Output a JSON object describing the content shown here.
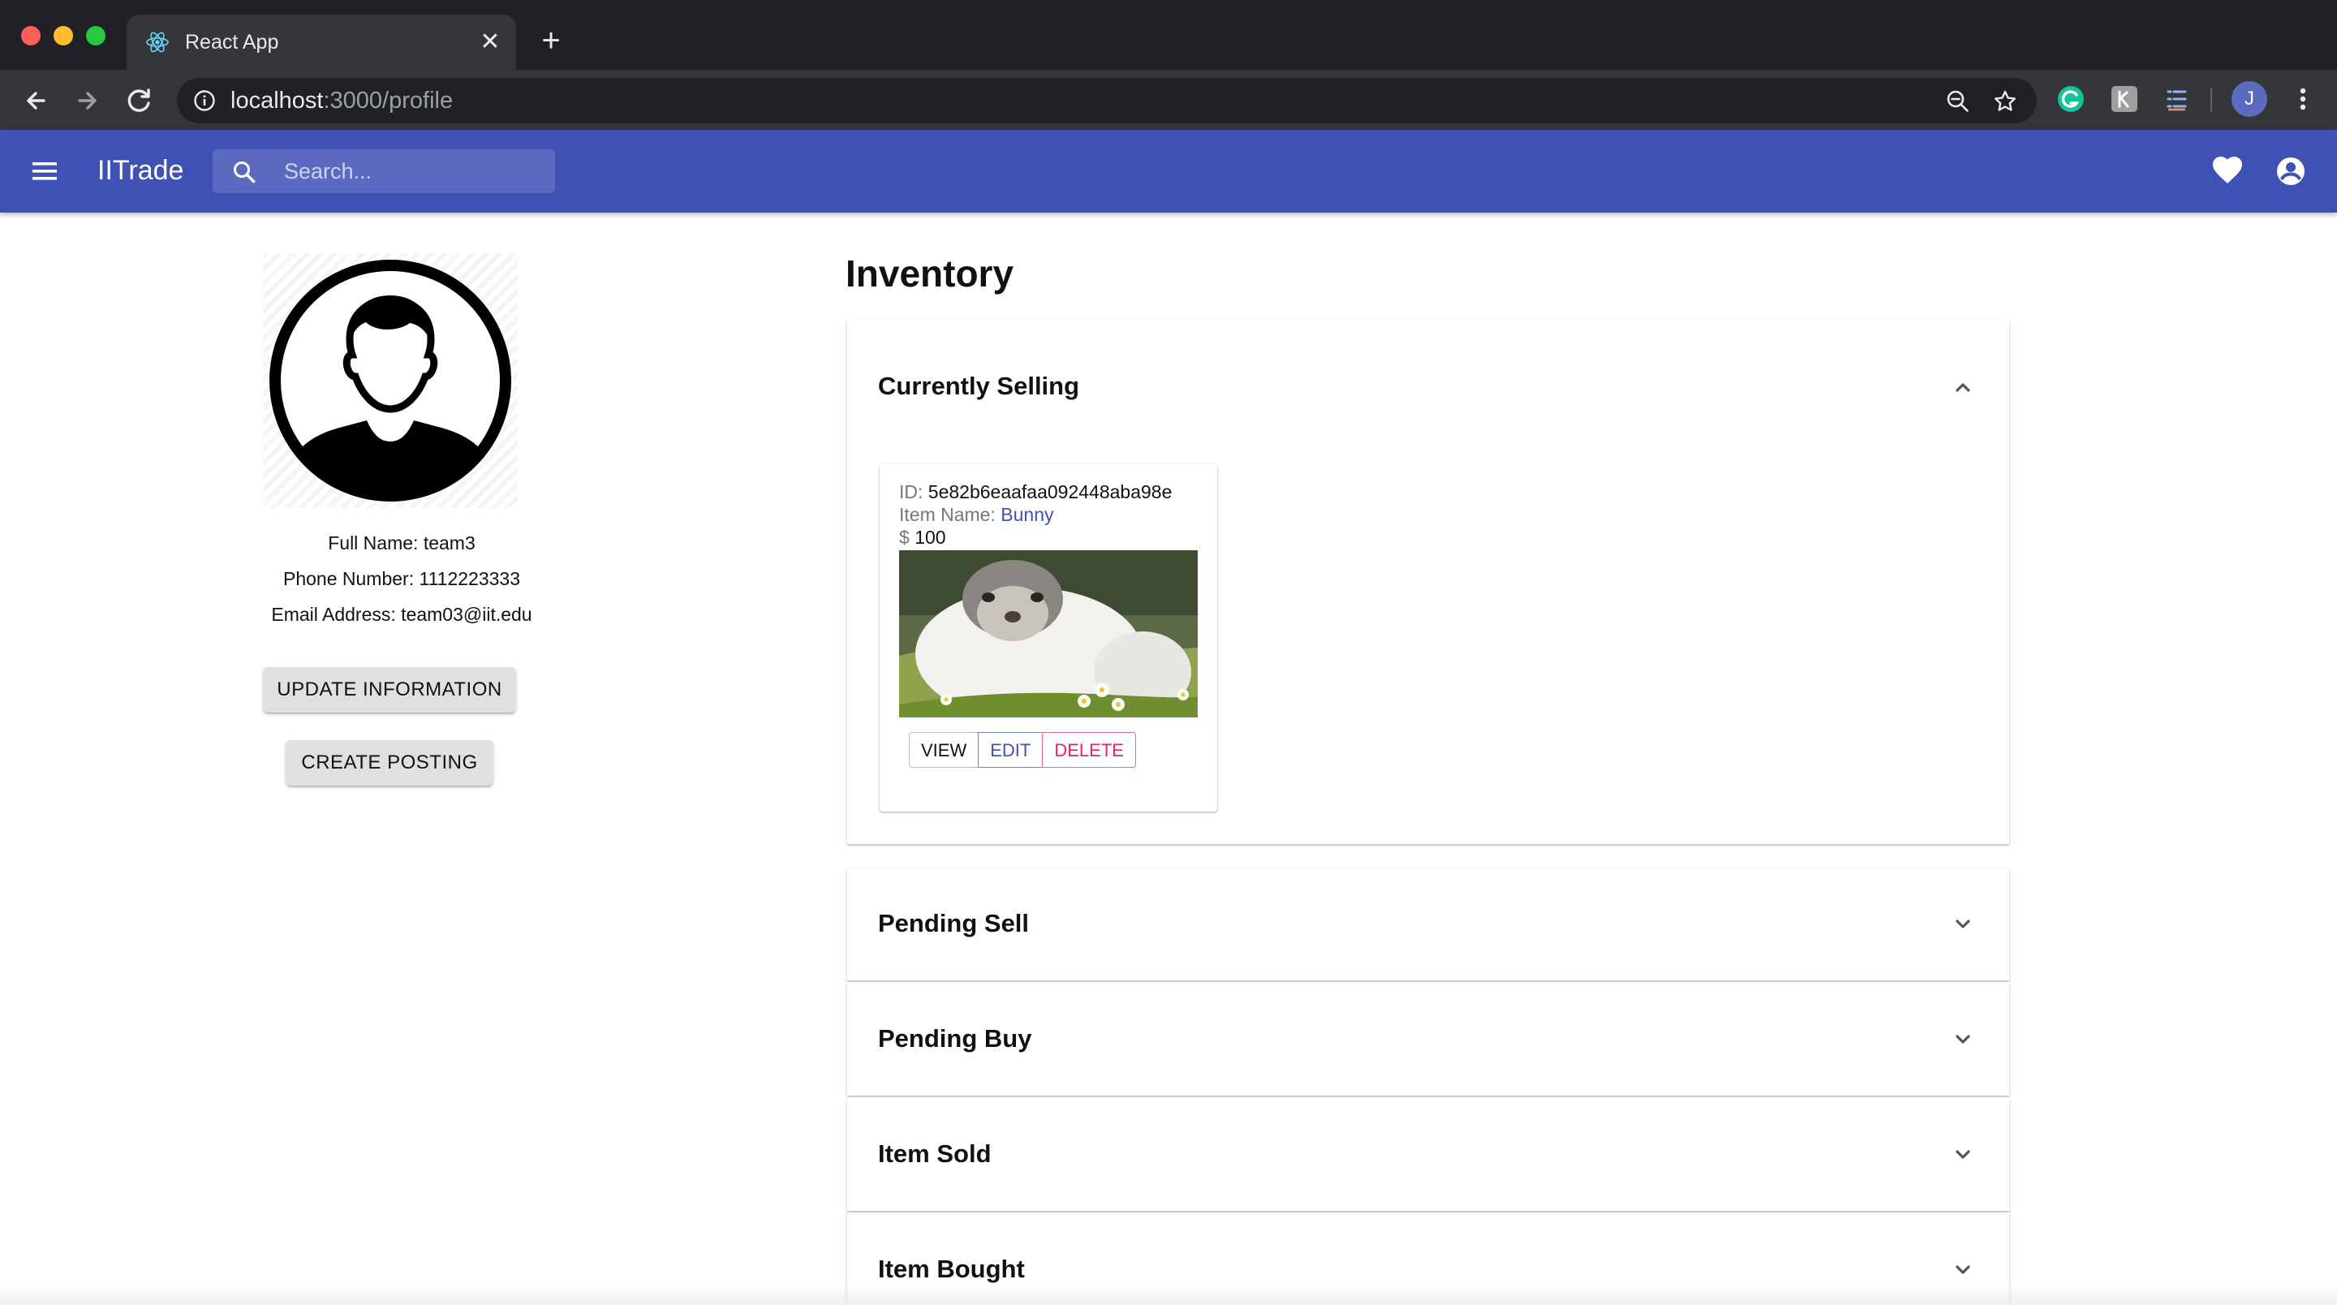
{
  "browser": {
    "tab_title": "React App",
    "url_host": "localhost",
    "url_path": ":3000/profile",
    "profile_initial": "J"
  },
  "app": {
    "brand": "IITrade",
    "search_placeholder": "Search..."
  },
  "profile": {
    "full_name": "Full Name: team3",
    "phone": "Phone Number: 1112223333",
    "email": "Email Address: team03@iit.edu",
    "update_button": "UPDATE INFORMATION",
    "create_button": "CREATE POSTING"
  },
  "inventory": {
    "title": "Inventory",
    "sections": [
      {
        "label": "Currently Selling",
        "expanded": true
      },
      {
        "label": "Pending Sell",
        "expanded": false
      },
      {
        "label": "Pending Buy",
        "expanded": false
      },
      {
        "label": "Item Sold",
        "expanded": false
      },
      {
        "label": "Item Bought",
        "expanded": false
      }
    ],
    "item": {
      "id_label": "ID:",
      "id_value": "5e82b6eaafaa092448aba98e",
      "name_label": "Item Name:",
      "name_value": "Bunny",
      "price_symbol": "$",
      "price_value": "100",
      "actions": {
        "view": "VIEW",
        "edit": "EDIT",
        "delete": "DELETE"
      }
    }
  },
  "colors": {
    "appbar": "#3f51b5",
    "primary": "#3f51b5",
    "danger": "#e91e63",
    "chrome_dark": "#202124"
  }
}
